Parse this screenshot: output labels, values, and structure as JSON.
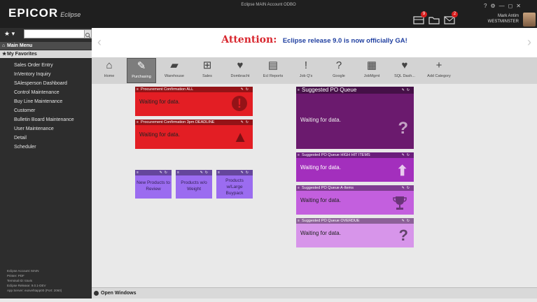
{
  "titlebar": {
    "logo": "EPICOR",
    "logo_sub": "Eclipse",
    "window_title": "Eclipse MAIN Account ODBO",
    "badges": {
      "messages": "9",
      "alerts": "2"
    },
    "user_name": "Mark Antim",
    "user_branch": "WESTMINSTER",
    "controls": [
      "?",
      "⚙",
      "—",
      "◻",
      "✕"
    ]
  },
  "sidebar": {
    "search_value": "",
    "main_menu_label": "Main Menu",
    "favorites_label": "My Favorites",
    "items": [
      "Sales Order Entry",
      "InVentory Inquiry",
      "SAlesperson Dashboard",
      "Control Maintenance",
      "Buy Line Maintenance",
      "Customer",
      "Bulletin Board Maintenance",
      "User Maintenance",
      "Detail",
      "Scheduler"
    ],
    "footer": [
      "Eclipse Account: MAIN",
      "Printer: PDF",
      "Terminal ID: travis",
      "Eclipse Release: 9.0.1-DEV",
      "App Server: eusvehtapp00 (Port: 2060)"
    ]
  },
  "announcement": {
    "attention": "Attention:",
    "message": "Eclipse release 9.0 is now officially GA!",
    "prev_arrow": "‹",
    "next_arrow": "›"
  },
  "categories": [
    {
      "label": "Home",
      "icon": "home-icon",
      "glyph": "⌂",
      "active": false
    },
    {
      "label": "Purchasing",
      "icon": "edit-icon",
      "glyph": "✎",
      "active": true
    },
    {
      "label": "Warehouse",
      "icon": "truck-icon",
      "glyph": "▰",
      "active": false
    },
    {
      "label": "Sales",
      "icon": "gift-icon",
      "glyph": "⊞",
      "active": false
    },
    {
      "label": "Dombracht",
      "icon": "heart-icon",
      "glyph": "♥",
      "active": false
    },
    {
      "label": "Ecl Reports",
      "icon": "document-icon",
      "glyph": "▤",
      "active": false
    },
    {
      "label": "Job Q's",
      "icon": "alert-icon",
      "glyph": "!",
      "active": false
    },
    {
      "label": "Google",
      "icon": "question-icon",
      "glyph": "?",
      "active": false
    },
    {
      "label": "JobMgmt",
      "icon": "calculator-icon",
      "glyph": "▦",
      "active": false
    },
    {
      "label": "SQL Dash...",
      "icon": "heart-icon",
      "glyph": "♥",
      "active": false
    },
    {
      "label": "Add Category",
      "icon": "plus-icon",
      "glyph": "+",
      "active": false
    }
  ],
  "widgets": {
    "proc_all": {
      "title": "Procurement Confirmation ALL",
      "body": "Waiting for data.",
      "icon": "!",
      "color": "#e31e24"
    },
    "proc_deadline": {
      "title": "Procurement Confirmation 3pm DEADLINE",
      "body": "Waiting for data.",
      "icon": "▲",
      "color": "#e31e24"
    },
    "new_products": {
      "title": "",
      "body": "New Products to Review",
      "color": "#9b6cf0"
    },
    "products_weight": {
      "title": "",
      "body": "Products w/o Weight",
      "color": "#9b6cf0"
    },
    "products_large": {
      "title": "",
      "body": "Products w/Large Buypack",
      "color": "#9b6cf0"
    },
    "po_queue": {
      "title": "Suggested PO Queue",
      "body": "Waiting for data.",
      "icon": "?",
      "color": "#6b1a6e"
    },
    "po_high_hit": {
      "title": "Suggested PO Queue HIGH HIT ITEMS",
      "body": "Waiting for data.",
      "icon": "⬆",
      "color": "#a32fbd"
    },
    "po_a_items": {
      "title": "Suggested PO Queue A-Items",
      "body": "Waiting for data.",
      "icon": "🏆",
      "color": "#c35fde"
    },
    "po_overdue": {
      "title": "Suggested PO Queue OVERDUE",
      "body": "Waiting for data.",
      "icon": "?",
      "color": "#d795ea"
    }
  },
  "bottombar": {
    "label": "Open Windows"
  }
}
